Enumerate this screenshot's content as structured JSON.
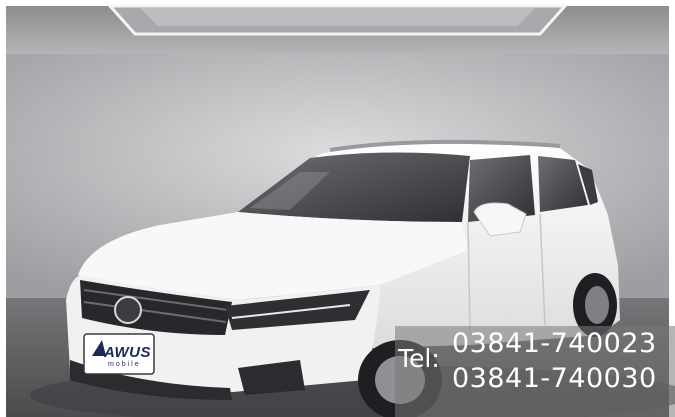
{
  "photo": {
    "subject": "white SUV in showroom",
    "colors": {
      "wall": "#c9c9cb",
      "floor": "#5f5f62",
      "car_body": "#f3f3f3",
      "overlay": "#787878"
    }
  },
  "plate": {
    "brand": "AWUS",
    "sub": "mobile"
  },
  "contact": {
    "label": "Tel:",
    "phone_1": "03841-740023",
    "phone_2": "03841-740030"
  }
}
